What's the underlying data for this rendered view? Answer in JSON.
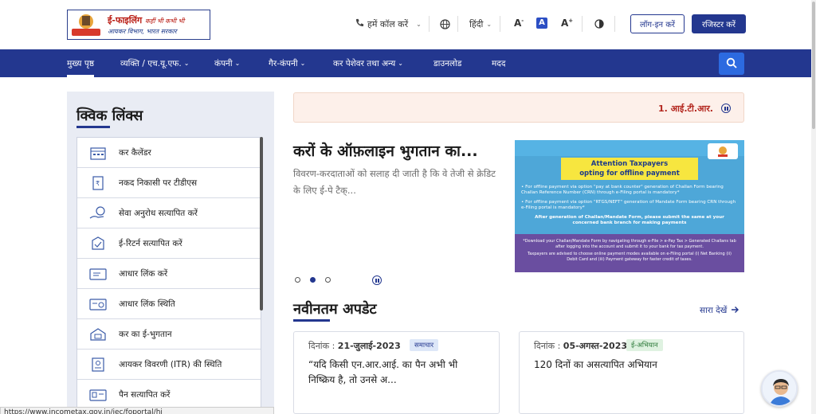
{
  "header": {
    "logo_title": "ई-फाइलिंग",
    "logo_tagline": "कहीं भी कभी भी",
    "logo_subtitle": "आयकर विभाग, भारत सरकार",
    "call_label": "हमें कॉल करें",
    "language_label": "हिंदी",
    "font_decrease": "A",
    "font_normal": "A",
    "font_increase": "A",
    "login_label": "लॉग-इन करें",
    "register_label": "रजिस्टर करें"
  },
  "nav": {
    "items": [
      {
        "label": "मुख्य पृष्ठ",
        "dropdown": false
      },
      {
        "label": "व्यक्ति / एच.यू.एफ.",
        "dropdown": true
      },
      {
        "label": "कंपनी",
        "dropdown": true
      },
      {
        "label": "गैर-कंपनी",
        "dropdown": true
      },
      {
        "label": "कर पेशेवर तथा अन्य",
        "dropdown": true
      },
      {
        "label": "डाउनलोड",
        "dropdown": false
      },
      {
        "label": "मदद",
        "dropdown": false
      }
    ]
  },
  "quick_links": {
    "title": "क्विक लिंक्स",
    "items": [
      {
        "label": "कर कैलेंडर",
        "icon": "calendar-icon"
      },
      {
        "label": "नकद निकासी पर टीडीएस",
        "icon": "cash-withdrawal-icon"
      },
      {
        "label": "सेवा अनुरोध सत्यापित करें",
        "icon": "service-request-icon"
      },
      {
        "label": "ई-रिटर्न सत्यापित करें",
        "icon": "everify-icon"
      },
      {
        "label": "आधार लिंक करें",
        "icon": "aadhaar-link-icon"
      },
      {
        "label": "आधार लिंक स्थिति",
        "icon": "aadhaar-status-icon"
      },
      {
        "label": "कर का ई-भुगतान",
        "icon": "epay-icon"
      },
      {
        "label": "आयकर विवरणी (ITR) की स्थिति",
        "icon": "itr-status-icon"
      },
      {
        "label": "पैन सत्यापित करें",
        "icon": "verify-pan-icon"
      }
    ]
  },
  "alert": {
    "text": "1. आई.टी.आर."
  },
  "carousel": {
    "title": "करों के ऑफ़लाइन भुगतान का...",
    "description_line1": "विवरण-करदाताओं को सलाह दी जाती है कि वे तेजी से क्रेडिट",
    "description_line2": "के लिए ई-पे टैक्...",
    "image": {
      "banner_line1": "Attention Taxpayers",
      "banner_line2": "opting for offline payment",
      "para1": "• For offline payment via option \"pay at bank counter\" generation of Challan Form bearing Challan Reference Number (CRN) through e-Filing portal is mandatory*",
      "para2": "• For offline payment via option \"RTGS/NEFT\" generation of Mandate Form bearing CRN through e-Filing portal is mandatory*",
      "para3": "After generation of Challan/Mandate Form, please submit the same at your concerned bank branch for making payments",
      "footer1": "*Download your Challan/Mandate Form by navigating through e-File > e-Pay Tax > Generated Challans tab after logging into the account and submit it to your bank for tax payment.",
      "footer2": "Taxpayers are advised to choose online payment modes available on e-Filing portal (i) Net Banking (ii) Debit Card and (iii) Payment gateway for faster credit of taxes."
    },
    "active_slide": 2,
    "slide_count": 3
  },
  "updates": {
    "title": "नवीनतम अपडेट",
    "see_all": "सारा देखें",
    "cards": [
      {
        "date_label": "दिनांक :",
        "date": "21-जुलाई-2023",
        "tag": "समाचार",
        "text_line1": "“यदि किसी एन.आर.आई. का पैन अभी भी",
        "text_line2": "निष्क्रिय है, तो उनसे अ..."
      },
      {
        "date_label": "दिनांक :",
        "date": "05-अगस्त-2023",
        "tag": "ई-अभियान",
        "text_line1": "120 दिनों का असत्यापित अभियान",
        "text_line2": ""
      }
    ]
  },
  "status_bar": {
    "url": "https://www.incometax.gov.in/iec/foportal/hi"
  },
  "colors": {
    "nav_bg": "#23378f",
    "alert_text": "#b3261e",
    "accent": "#2c6ae0"
  }
}
